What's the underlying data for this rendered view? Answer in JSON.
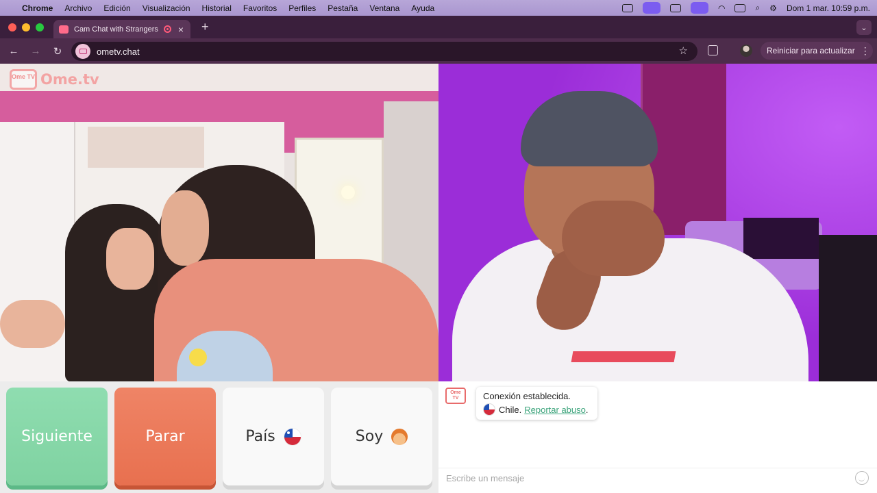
{
  "menubar": {
    "app": "Chrome",
    "items": [
      "Archivo",
      "Edición",
      "Visualización",
      "Historial",
      "Favoritos",
      "Perfiles",
      "Pestaña",
      "Ventana",
      "Ayuda"
    ],
    "datetime": "Dom 1 mar.  10:59 p.m."
  },
  "browser": {
    "tab_title": "Cam Chat with Strangers",
    "url": "ometv.chat",
    "update_label": "Reiniciar para actualizar"
  },
  "site": {
    "logo_badge": "Ome TV",
    "logo_text": "Ome.tv"
  },
  "controls": {
    "next_label": "Siguiente",
    "stop_label": "Parar",
    "country_label": "País",
    "gender_label": "Soy"
  },
  "chat": {
    "badge": "Ome TV",
    "status": "Conexión establecida.",
    "country": "Chile.",
    "report_link": "Reportar abuso",
    "report_suffix": ".",
    "input_placeholder": "Escribe un mensaje"
  },
  "colors": {
    "next_button": "#8fddb0",
    "stop_button": "#ef8466",
    "report_link": "#3aa37a",
    "brand": "#e86b6b"
  },
  "icons": [
    "apple-icon",
    "wifi-icon",
    "battery-icon",
    "search-icon",
    "control-center-icon",
    "back-icon",
    "forward-icon",
    "reload-icon",
    "star-icon",
    "extensions-icon",
    "chile-flag-icon",
    "boy-emoji-icon",
    "smiley-icon"
  ]
}
